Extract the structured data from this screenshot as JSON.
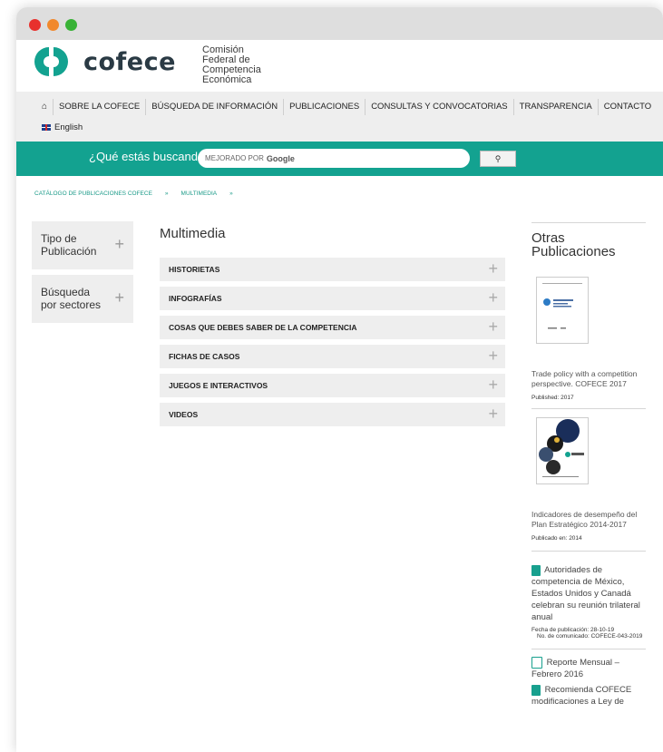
{
  "window": {
    "controls": [
      "close",
      "minimize",
      "maximize"
    ]
  },
  "brand": {
    "name": "cofece",
    "subtitle": [
      "Comisión",
      "Federal de",
      "Competencia",
      "Económica"
    ],
    "color": "#13a290"
  },
  "nav": {
    "home_icon": "home-icon",
    "items": [
      "SOBRE LA COFECE",
      "BÚSQUEDA DE INFORMACIÓN",
      "PUBLICACIONES",
      "CONSULTAS Y CONVOCATORIAS",
      "TRANSPARENCIA",
      "CONTACTO"
    ],
    "language": "English"
  },
  "search": {
    "question": "¿Qué estás buscando?",
    "placeholder_prefix": "MEJORADO POR",
    "placeholder_brand": "Google",
    "button_icon": "search-icon"
  },
  "breadcrumb": [
    "CATÁLOGO DE PUBLICACIONES COFECE",
    "»",
    "MULTIMEDIA",
    "»"
  ],
  "sidebar": [
    {
      "label": "Tipo de Publicación"
    },
    {
      "label": "Búsqueda por sectores"
    }
  ],
  "main": {
    "title": "Multimedia",
    "sections": [
      "HISTORIETAS",
      "INFOGRAFÍAS",
      "COSAS QUE DEBES SABER DE LA COMPETENCIA",
      "FICHAS DE CASOS",
      "JUEGOS E INTERACTIVOS",
      "VIDEOS"
    ],
    "plus": "+"
  },
  "right": {
    "title": "Otras Publicaciones",
    "items": [
      {
        "title": "Trade policy with a competition perspective. COFECE 2017",
        "meta": "Published: 2017"
      },
      {
        "title": "Indicadores de desempeño del Plan Estratégico 2014-2017",
        "meta": "Publicado en: 2014"
      },
      {
        "title": "Autoridades de competencia de México, Estados Unidos y Canadá celebran su reunión trilateral anual",
        "meta1": "Fecha de publicación: 28-10-19",
        "meta2": "No. de comunicado: COFECE-043-2019"
      },
      {
        "title": "Reporte Mensual – Febrero 2016"
      },
      {
        "title": "Recomienda COFECE modificaciones a Ley de"
      }
    ]
  }
}
